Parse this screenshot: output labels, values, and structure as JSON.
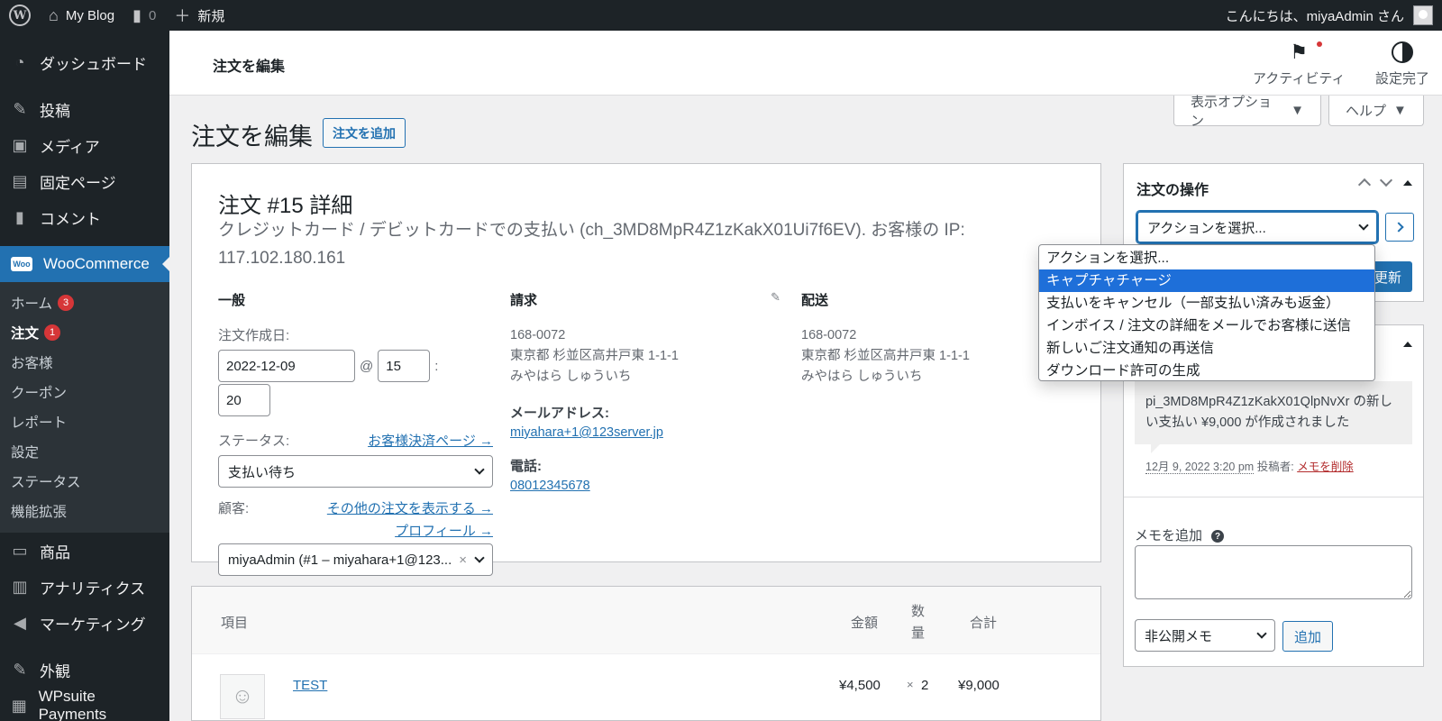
{
  "admin_bar": {
    "site_name": "My Blog",
    "comments_count": "0",
    "new_label": "新規",
    "greeting": "こんにちは、miyaAdmin さん"
  },
  "sidebar": {
    "dashboard": "ダッシュボード",
    "posts": "投稿",
    "media": "メディア",
    "pages": "固定ページ",
    "comments": "コメント",
    "woocommerce": "WooCommerce",
    "woo_logo_text": "Woo",
    "sub": {
      "home": "ホーム",
      "home_badge": "3",
      "orders": "注文",
      "orders_badge": "1",
      "customers": "お客様",
      "coupons": "クーポン",
      "reports": "レポート",
      "settings": "設定",
      "status": "ステータス",
      "extensions": "機能拡張"
    },
    "products": "商品",
    "analytics": "アナリティクス",
    "marketing": "マーケティング",
    "appearance": "外観",
    "wpsuite": "WPsuite Payments"
  },
  "header": {
    "title": "注文を編集",
    "activity": "アクティビティ",
    "setup_complete": "設定完了"
  },
  "screen_options": "表示オプション",
  "help": "ヘルプ",
  "page": {
    "title": "注文を編集",
    "add_order": "注文を追加"
  },
  "order": {
    "heading": "注文 #15 詳細",
    "meta": "クレジットカード / デビットカードでの支払い (ch_3MD8MpR4Z1zKakX01Ui7f6EV). お客様の IP: 117.102.180.161",
    "general": {
      "heading": "一般",
      "date_label": "注文作成日:",
      "date": "2022-12-09",
      "at": "@",
      "hour": "15",
      "colon": ":",
      "minute": "20",
      "status_label": "ステータス:",
      "payment_page_link": "お客様決済ページ →",
      "status": "支払い待ち",
      "customer_label": "顧客:",
      "other_orders_link": "その他の注文を表示する →",
      "profile_link": "プロフィール →",
      "customer": "miyaAdmin (#1 – miyahara+1@123...",
      "clear": "×"
    },
    "billing": {
      "heading": "請求",
      "postal": "168-0072",
      "address": "東京都 杉並区高井戸東 1-1-1",
      "name": "みやはら しゅういち",
      "email_label": "メールアドレス:",
      "email": "miyahara+1@123server.jp",
      "phone_label": "電話:",
      "phone": "08012345678"
    },
    "shipping": {
      "heading": "配送",
      "postal": "168-0072",
      "address": "東京都 杉並区高井戸東 1-1-1",
      "name": "みやはら しゅういち"
    }
  },
  "items": {
    "headers": {
      "item": "項目",
      "cost": "金額",
      "qty_1": "数",
      "qty_2": "量",
      "total": "合計"
    },
    "rows": [
      {
        "name": "TEST",
        "cost": "¥4,500",
        "times": "×",
        "qty": "2",
        "total": "¥9,000"
      }
    ]
  },
  "actions": {
    "title": "注文の操作",
    "select_value": "アクションを選択...",
    "update_label": "更新",
    "options": [
      "アクションを選択...",
      "キャプチャチャージ",
      "支払いをキャンセル（一部支払い済みも返金）",
      "インボイス / 注文の詳細をメールでお客様に送信",
      "新しいご注文通知の再送信",
      "ダウンロード許可の生成"
    ],
    "highlighted_index": 1
  },
  "notes": {
    "note_text": "pi_3MD8MpR4Z1zKakX01QlpNvXr の新しい支払い ¥9,000 が作成されました",
    "date": "12月 9, 2022 3:20 pm",
    "by": "投稿者:",
    "delete": "メモを削除",
    "add_label": "メモを追加",
    "help": "?",
    "type": "非公開メモ",
    "add_button": "追加"
  }
}
